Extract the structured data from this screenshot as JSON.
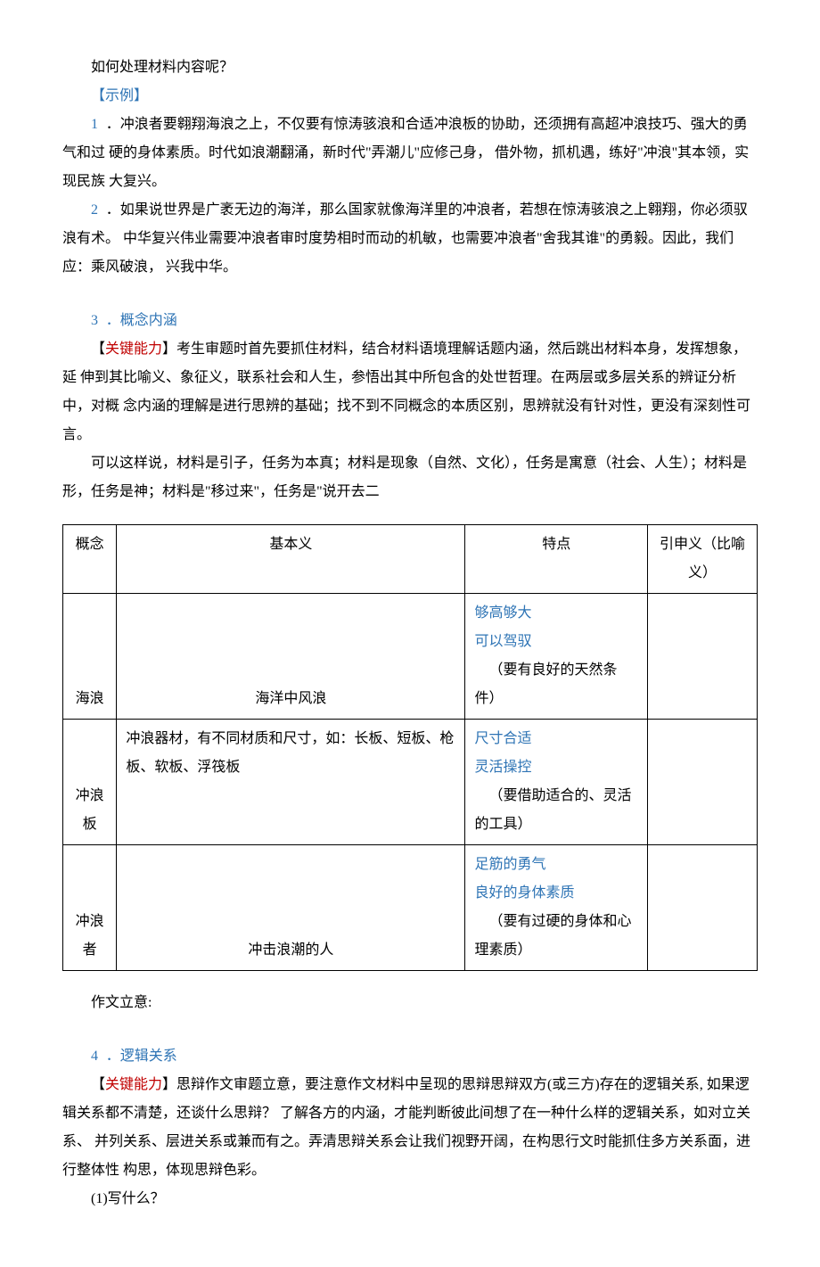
{
  "q1": "如何处理材料内容呢？",
  "example_label": "【示例】",
  "ex1_num": "1",
  "ex1": " ．冲浪者要翱翔海浪之上，不仅要有惊涛骇浪和合适冲浪板的协助，还须拥有高超冲浪技巧、强大的勇气和过  硬的身体素质。时代如浪潮翻涌，新时代\"弄潮儿\"应修己身， 借外物，抓机遇，练好\"冲浪\"其本领，实现民族 大复兴。",
  "ex2_num": "2",
  "ex2": " ．如果说世界是广袤无边的海洋，那么国家就像海洋里的冲浪者，若想在惊涛骇浪之上翱翔，你必须驭浪有术。  中华复兴伟业需要冲浪者审时度势相时而动的机敏，也需要冲浪者\"舍我其谁\"的勇毅。因此，我们应：乘风破浪，  兴我中华。",
  "sec3_num": "3",
  "sec3_title": " ．概念内涵",
  "key_ability_label": "【",
  "key_ability_red": "关键能力",
  "key_ability_close": "】",
  "sec3_p1": "考生审题时首先要抓住材料，结合材料语境理解话题内涵，然后跳出材料本身，发挥想象，延  伸到其比喻义、象征义，联系社会和人生，参悟出其中所包含的处世哲理。在两层或多层关系的辨证分析中，对概  念内涵的理解是进行思辨的基础；找不到不同概念的本质区别，思辨就没有针对性，更没有深刻性可言。",
  "sec3_p2": "可以这样说，材料是引子，任务为本真；材料是现象（自然、文化），任务是寓意（社会、人生）；材料是形，任务是神；材料是\"移过来\"，任务是\"说开去二",
  "table": {
    "headers": [
      "概念",
      "基本义",
      "特点",
      "引申义（比喻义）"
    ],
    "rows": [
      {
        "c1": "海浪",
        "c2": "海洋中风浪",
        "c3_l1": "够高够大",
        "c3_l2": "可以驾驭",
        "c3_l3": "（要有良好的天然条件）",
        "c4": ""
      },
      {
        "c1": "冲浪板",
        "c2": "冲浪器材，有不同材质和尺寸，如：长板、短板、枪板、软板、浮筏板",
        "c3_l1": "尺寸合适",
        "c3_l2": "灵活操控",
        "c3_l3": "（要借助适合的、灵活的工具）",
        "c4": ""
      },
      {
        "c1": "冲浪者",
        "c2": "冲击浪潮的人",
        "c3_l1": "足筋的勇气",
        "c3_l2": "良好的身体素质",
        "c3_l3": "（要有过硬的身体和心理素质）",
        "c4": ""
      }
    ]
  },
  "essay_topic": "作文立意:",
  "sec4_num": "4",
  "sec4_title": " ．逻辑关系",
  "sec4_p1": "思辩作文审题立意，要注意作文材料中呈现的思辩思辩双方(或三方)存在的逻辑关系, 如果逻 辑关系都不清楚，还谈什么思辩？  了解各方的内涵，才能判断彼此间想了在一种什么样的逻辑关系，如对立关系、 并列关系、层进关系或兼而有之。弄清思辩关系会让我们视野开阔，在构思行文时能抓住多方关系面，进行整体性 构思，体现思辩色彩。",
  "sec4_q1": "(1)写什么？"
}
